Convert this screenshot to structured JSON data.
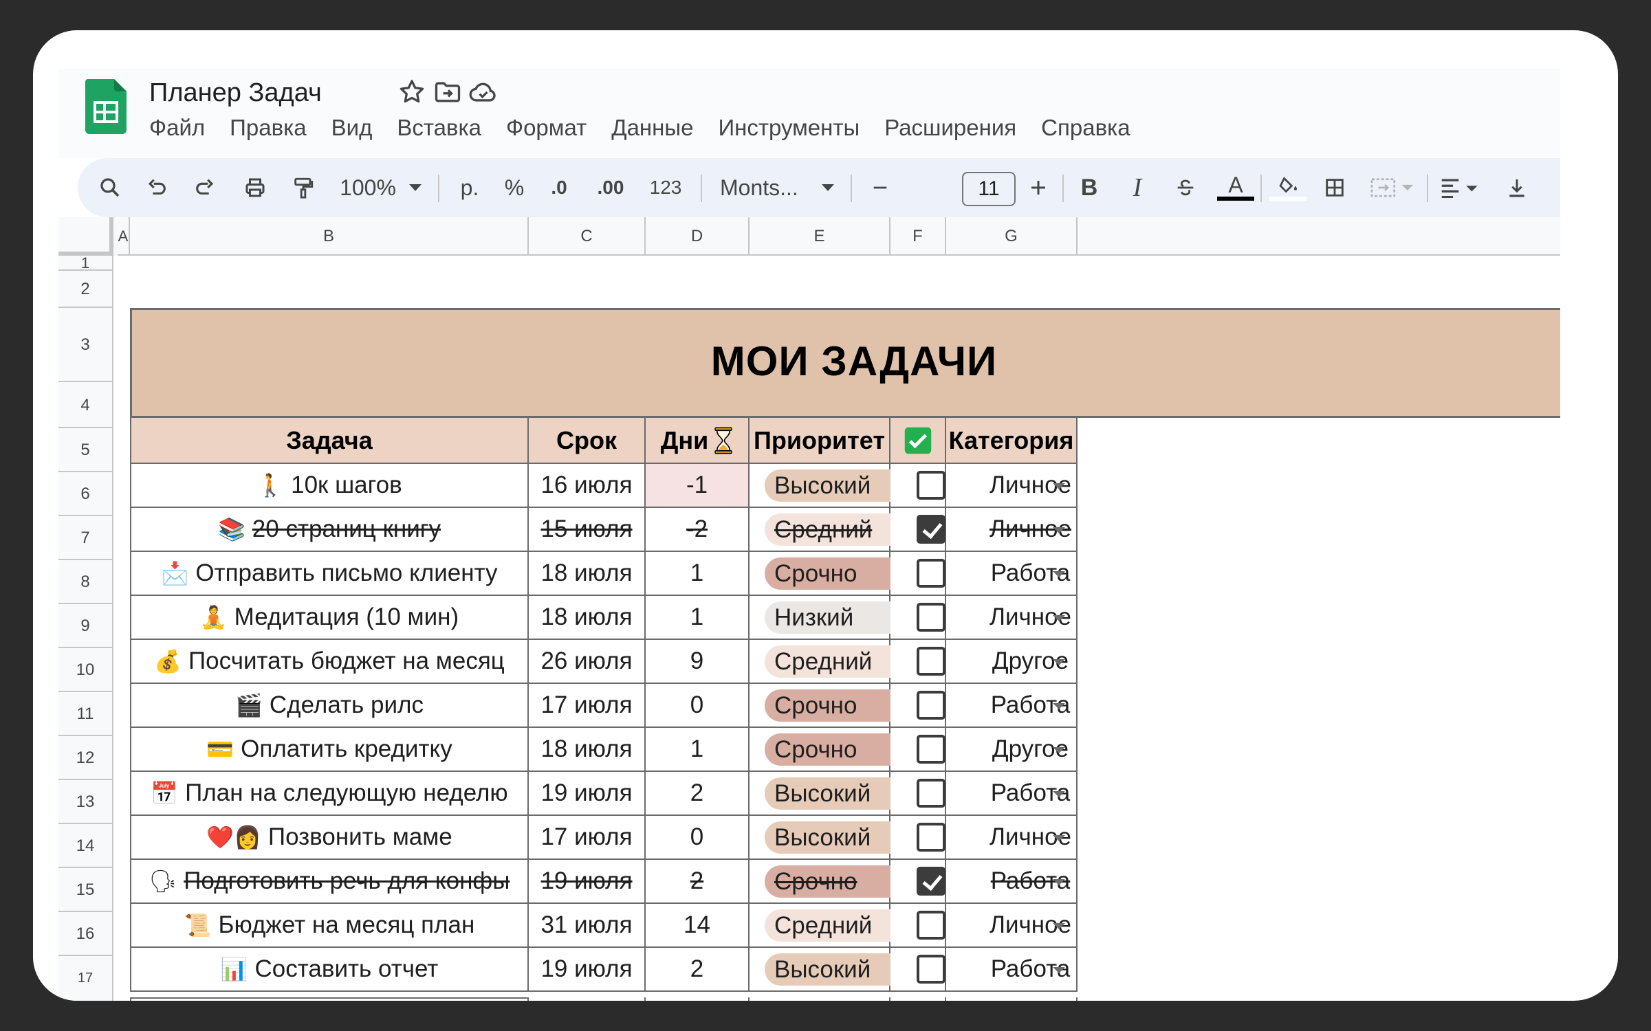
{
  "app": {
    "title": "Планер Задач",
    "menu": [
      "Файл",
      "Правка",
      "Вид",
      "Вставка",
      "Формат",
      "Данные",
      "Инструменты",
      "Расширения",
      "Справка"
    ]
  },
  "toolbar": {
    "zoom": "100%",
    "currency": "р.",
    "percent": "%",
    "decrease_decimal": ".0",
    "increase_decimal": ".00",
    "number_format": "123",
    "font": "Monts...",
    "font_size": "11",
    "bold": "B",
    "italic": "I",
    "text_color": "A"
  },
  "columns": [
    "A",
    "B",
    "C",
    "D",
    "E",
    "F",
    "G"
  ],
  "row_numbers": [
    "1",
    "2",
    "3",
    "4",
    "5",
    "6",
    "7",
    "8",
    "9",
    "10",
    "11",
    "12",
    "13",
    "14",
    "15",
    "16",
    "17"
  ],
  "sheet": {
    "title": "МОИ ЗАДАЧИ",
    "headers": {
      "task": "Задача",
      "due": "Срок",
      "days": "Дни",
      "priority": "Приоритет",
      "category": "Категория"
    },
    "rows": [
      {
        "emoji": "🚶",
        "task": "10к шагов",
        "due": "16 июля",
        "days": "-1",
        "priority": "Высокий",
        "done": false,
        "category": "Личное"
      },
      {
        "emoji": "📚",
        "task": "20 страниц книгу",
        "due": "15 июля",
        "days": "-2",
        "priority": "Средний",
        "done": true,
        "category": "Личное"
      },
      {
        "emoji": "📩",
        "task": "Отправить письмо клиенту",
        "due": "18 июля",
        "days": "1",
        "priority": "Срочно",
        "done": false,
        "category": "Работа"
      },
      {
        "emoji": "🧘",
        "task": "Медитация (10 мин)",
        "due": "18 июля",
        "days": "1",
        "priority": "Низкий",
        "done": false,
        "category": "Личное"
      },
      {
        "emoji": "💰",
        "task": "Посчитать бюджет на месяц",
        "due": "26 июля",
        "days": "9",
        "priority": "Средний",
        "done": false,
        "category": "Другое"
      },
      {
        "emoji": "🎬",
        "task": "Сделать рилс",
        "due": "17 июля",
        "days": "0",
        "priority": "Срочно",
        "done": false,
        "category": "Работа"
      },
      {
        "emoji": "💳",
        "task": "Оплатить кредитку",
        "due": "18 июля",
        "days": "1",
        "priority": "Срочно",
        "done": false,
        "category": "Другое"
      },
      {
        "emoji": "📅",
        "task": "План на следующую неделю",
        "due": "19 июля",
        "days": "2",
        "priority": "Высокий",
        "done": false,
        "category": "Работа"
      },
      {
        "emoji": "❤️👩",
        "task": "Позвонить маме",
        "due": "17 июля",
        "days": "0",
        "priority": "Высокий",
        "done": false,
        "category": "Личное"
      },
      {
        "emoji": "🗣",
        "task": "Подготовить речь для конфы",
        "due": "19 июля",
        "days": "2",
        "priority": "Срочно",
        "done": true,
        "category": "Работа"
      },
      {
        "emoji": "📜",
        "task": "Бюджет на месяц план",
        "due": "31 июля",
        "days": "14",
        "priority": "Средний",
        "done": false,
        "category": "Личное"
      },
      {
        "emoji": "📊",
        "task": "Составить отчет",
        "due": "19 июля",
        "days": "2",
        "priority": "Высокий",
        "done": false,
        "category": "Работа"
      }
    ]
  },
  "colors": {
    "title_band": "#e0c2ab",
    "header_row": "#ecd3c3",
    "priority_high": "#e6cbb9",
    "priority_medium": "#f4e3db",
    "priority_urgent": "#d9aea2",
    "priority_low": "#ebe7e4",
    "overdue_cell": "#f6e2e3",
    "sheets_green": "#1ea362",
    "checkbox_header": "#24b04e"
  }
}
